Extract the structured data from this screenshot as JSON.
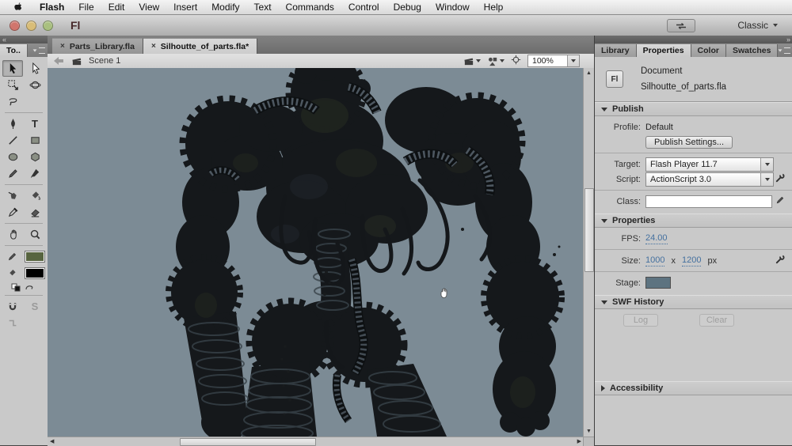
{
  "menu_bar": {
    "items": [
      "Flash",
      "File",
      "Edit",
      "View",
      "Insert",
      "Modify",
      "Text",
      "Commands",
      "Control",
      "Debug",
      "Window",
      "Help"
    ]
  },
  "title_bar": {
    "app_initials": "Fl",
    "workspace": "Classic"
  },
  "glyphs": {
    "close": "×",
    "text_tool": "T",
    "smooth_option": "S",
    "collapse_left": "«",
    "collapse_right": "»"
  },
  "tools_panel": {
    "tab_label": "To..",
    "tools": [
      "selection",
      "subselection",
      "free-transform",
      "3d-rotation",
      "lasso",
      "pen",
      "text",
      "line",
      "rectangle",
      "oval",
      "polystar",
      "pencil",
      "brush",
      "ink-bottle",
      "paint-bucket",
      "eyedropper",
      "eraser",
      "hand",
      "zoom"
    ],
    "stroke_color": "#57643f",
    "fill_color": "#000000"
  },
  "document_tabs": [
    {
      "label": "Parts_Library.fla",
      "active": false
    },
    {
      "label": "Silhoutte_of_parts.fla*",
      "active": true
    }
  ],
  "edit_bar": {
    "scene_label": "Scene 1",
    "zoom_value": "100%"
  },
  "canvas": {
    "background": "#7c8b95"
  },
  "right_panel": {
    "tabs": [
      "Library",
      "Properties",
      "Color",
      "Swatches"
    ],
    "active_tab": "Properties",
    "document": {
      "icon_label": "Fl",
      "type_label": "Document",
      "filename": "Silhoutte_of_parts.fla"
    },
    "publish": {
      "header": "Publish",
      "profile_label": "Profile:",
      "profile_value": "Default",
      "publish_settings_button": "Publish Settings...",
      "target_label": "Target:",
      "target_value": "Flash Player 11.7",
      "script_label": "Script:",
      "script_value": "ActionScript 3.0",
      "class_label": "Class:",
      "class_value": ""
    },
    "properties": {
      "header": "Properties",
      "fps_label": "FPS:",
      "fps_value": "24.00",
      "size_label": "Size:",
      "size_width": "1000",
      "size_x": "x",
      "size_height": "1200",
      "size_unit": "px",
      "stage_label": "Stage:",
      "stage_color": "#5d7380"
    },
    "swf_history": {
      "header": "SWF History",
      "log_button": "Log",
      "clear_button": "Clear"
    },
    "accessibility": {
      "header": "Accessibility"
    }
  }
}
